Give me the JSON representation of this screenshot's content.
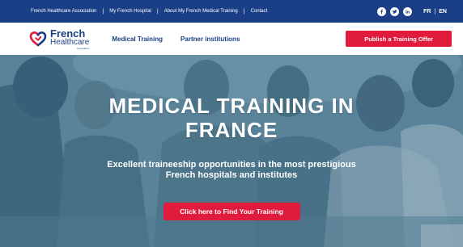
{
  "topbar": {
    "links": [
      "French Healthcare Association",
      "My French Hospital",
      "About My French Medical Training",
      "Contact"
    ],
    "separator": "|",
    "social": [
      "facebook-icon",
      "twitter-icon",
      "linkedin-icon"
    ],
    "lang": {
      "fr": "FR",
      "separator": "|",
      "en": "EN"
    }
  },
  "brand": {
    "line1": "French",
    "line2": "Healthcare",
    "line3": "Association"
  },
  "nav": {
    "items": [
      "Medical Training",
      "Partner institutions"
    ],
    "publish_label": "Publish a Training Offer"
  },
  "hero": {
    "title": "MEDICAL TRAINING IN FRANCE",
    "subtitle": "Excellent traineeship opportunities in the most prestigious French hospitals and institutes",
    "cta_label": "Click here to Find Your Training"
  },
  "colors": {
    "primary_navy": "#1b3f87",
    "accent_red": "#e01b3c",
    "hero_tint": "#5d8396"
  }
}
